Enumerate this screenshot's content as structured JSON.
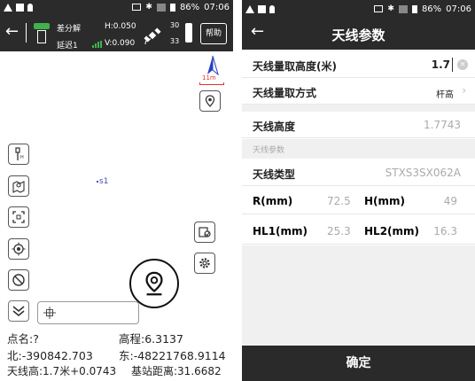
{
  "left": {
    "status": {
      "battery": "86%",
      "time": "07:06"
    },
    "header": {
      "solution": "差分解",
      "delay": "延迟1",
      "h_precision": "H:0.050",
      "v_precision": "V:0.090",
      "sats_top": "30",
      "sats_bottom": "33",
      "help_label": "帮助"
    },
    "map": {
      "scale_label": "11m",
      "point_label": "s1"
    },
    "info": {
      "point_name": "点名:?",
      "elevation": "高程:6.3137",
      "north": "北:-390842.703",
      "east": "东:-48221768.9114",
      "antenna": "天线高:1.7米+0.0743",
      "base_distance": "基站距离:31.6682"
    }
  },
  "right": {
    "status": {
      "battery": "86%",
      "time": "07:06"
    },
    "title": "天线参数",
    "rows": {
      "measure_height_label": "天线量取高度(米)",
      "measure_height_value": "1.7",
      "measure_method_label": "天线量取方式",
      "measure_method_value": "杆高",
      "antenna_height_label": "天线高度",
      "antenna_height_value": "1.7743"
    },
    "section_label": "天线参数",
    "antenna_type_label": "天线类型",
    "antenna_type_value": "STXS3SX062A",
    "params": {
      "r_label": "R(mm)",
      "r_value": "72.5",
      "h_label": "H(mm)",
      "h_value": "49",
      "hl1_label": "HL1(mm)",
      "hl1_value": "25.3",
      "hl2_label": "HL2(mm)",
      "hl2_value": "16.3"
    },
    "confirm_label": "确定"
  },
  "colors": {
    "header_bg": "#2b2b2b",
    "accent_green": "#3fb24d",
    "north_blue": "#2940c0",
    "point_blue": "#3d4eb8"
  }
}
